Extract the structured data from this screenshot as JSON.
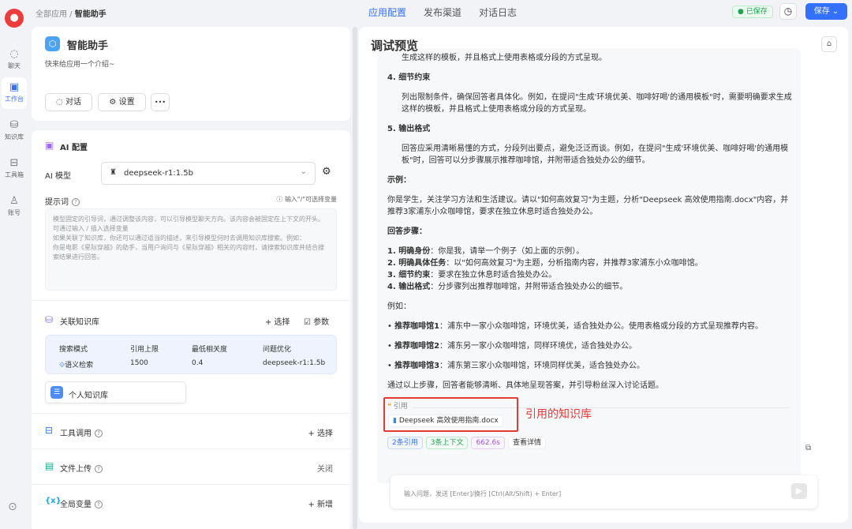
{
  "sidebar": {
    "items": [
      {
        "label": "聊天",
        "icon": "chat-icon"
      },
      {
        "label": "工作台",
        "icon": "robot-icon",
        "active": true
      },
      {
        "label": "知识库",
        "icon": "database-icon"
      },
      {
        "label": "工具箱",
        "icon": "toolbox-icon"
      },
      {
        "label": "账号",
        "icon": "user-icon"
      }
    ]
  },
  "breadcrumb": {
    "root": "全部应用",
    "current": "智能助手"
  },
  "tabs": [
    "应用配置",
    "发布渠道",
    "对话日志"
  ],
  "header": {
    "saved": "● 已保存",
    "save": "保存"
  },
  "app": {
    "name": "智能助手",
    "intro": "快来给应用一个介绍~",
    "chat_btn": "对话",
    "settings_btn": "设置",
    "more": "•••"
  },
  "ai": {
    "title": "AI 配置",
    "model_label": "AI 模型",
    "model": "deepseek-r1:1.5b",
    "prompt_label": "提示词",
    "prompt_hint": "输入\"/\"可选择变量",
    "prompt_placeholder": "模型固定的引导词，通过调整该内容，可以引导模型聊天方向。该内容会被固定在上下文的开头。可通过输入 / 插入选择变量\n如果关联了知识库，你还可以通过适当的描述，来引导模型何时去调用知识库搜索。例如：\n你是电影《星际穿越》的助手，当用户询问与《星际穿越》相关的内容时，请搜索知识库并结合搜索结果进行回答。"
  },
  "kb": {
    "title": "关联知识库",
    "select": "+ 选择",
    "params": "参数",
    "headers": [
      "搜索模式",
      "引用上限",
      "最低相关度",
      "问题优化"
    ],
    "values": [
      "语义检索",
      "1500",
      "0.4",
      "deepseek-r1:1.5b"
    ],
    "item": "个人知识库"
  },
  "sections": [
    {
      "title": "工具调用",
      "action": "+ 选择"
    },
    {
      "title": "文件上传",
      "action": "关闭"
    },
    {
      "title": "全局变量",
      "action": "+ 新增"
    }
  ],
  "preview": {
    "title": "调试预览",
    "lines": {
      "l0": "生成这样的模板，并且格式上使用表格或分段的方式呈现。",
      "h4": "4. 细节约束",
      "p4": "列出限制条件，确保回答者具体化。例如，在提问\"生成'环境优美、咖啡好喝'的通用模板\"时，需要明确要求生成这样的模板，并且格式上使用表格或分段的方式呈现。",
      "h5": "5. 输出格式",
      "p5": "回答应采用清晰易懂的方式，分段列出要点，避免泛泛而谈。例如，在提问\"生成'环境优美、咖啡好喝'的通用模板\"时，回答可以分步骤展示推荐咖啡馆，并附带适合独处办公的细节。",
      "ex": "示例：",
      "exp": "你是学生，关注学习方法和生活建议。请以\"如何高效复习\"为主题，分析\"Deepseek 高效使用指南.docx\"内容，并推荐3家浦东小众咖啡馆，要求在独立休息时适合独处办公。",
      "steps": "回答步骤：",
      "s1b": "1. 明确身份",
      "s1": "：你是我，请举一个例子（如上面的示例）。",
      "s2b": "2. 明确具体任务",
      "s2": "：以\"如何高效复习\"为主题，分析指南内容，并推荐3家浦东小众咖啡馆。",
      "s3b": "3. 细节约束",
      "s3": "：要求在独立休息时适合独处办公。",
      "s4b": "4. 输出格式",
      "s4": "：分步骤列出推荐咖啡馆，并附带适合独处办公的细节。",
      "eg": "例如：",
      "b1b": "推荐咖啡馆1",
      "b1": "：浦东中一家小众咖啡馆，环境优美，适合独处办公。使用表格或分段的方式呈现推荐内容。",
      "b2b": "推荐咖啡馆2",
      "b2": "：浦东另一家小众咖啡馆，同样环境优，适合独处办公。",
      "b3b": "推荐咖啡馆3",
      "b3": "：浦东第三家小众咖啡馆，环境同样优美，适合独处办公。",
      "end": "通过以上步骤，回答者能够清晰、具体地呈现答案，并引导粉丝深入讨论话题。"
    },
    "quote_label": "引用",
    "quote_file": "Deepseek 高效使用指南.docx",
    "annotation": "引用的知识库",
    "tags": [
      "2条引用",
      "3条上下文",
      "662.6s",
      "查看详情"
    ],
    "input_placeholder": "输入问题，发送 [Enter]/换行 [Ctrl(Alt/Shift) + Enter]"
  },
  "colors": {
    "accent": "#3370ff",
    "annotation": "#e53935"
  }
}
